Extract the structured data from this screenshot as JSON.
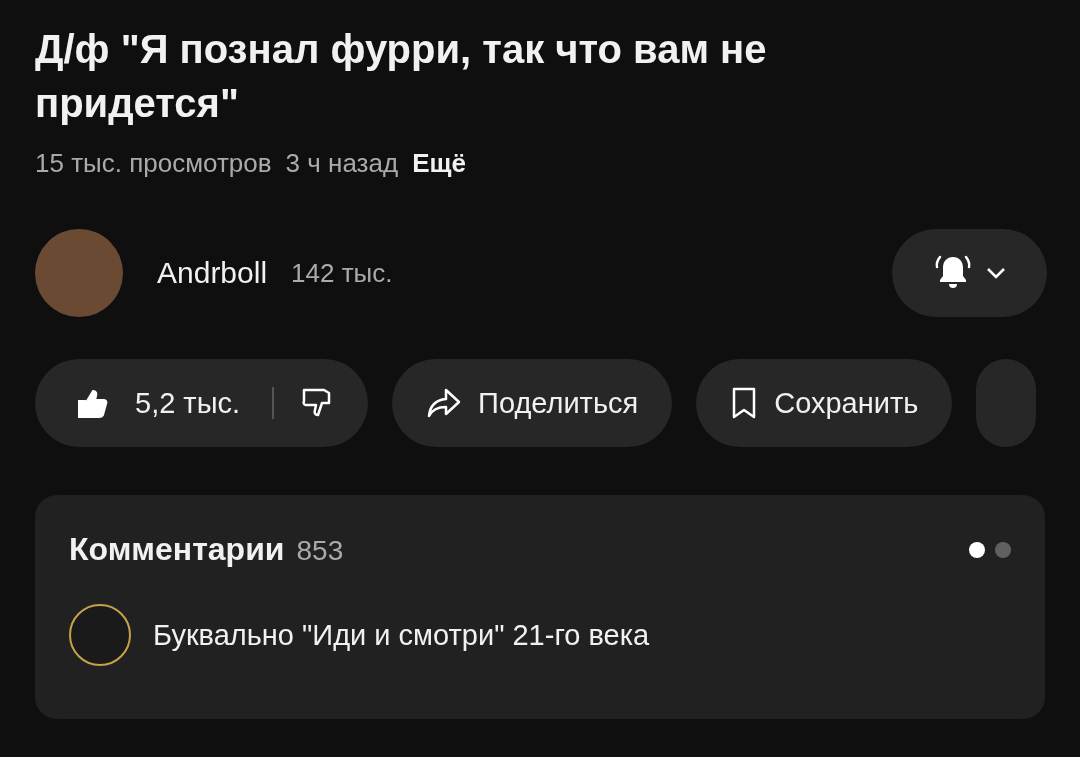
{
  "video": {
    "title": "Д/ф \"Я познал фурри, так что вам не придется\"",
    "views": "15 тыс. просмотров",
    "age": "3 ч назад",
    "more": "Ещё"
  },
  "channel": {
    "name": "Andrboll",
    "subscribers": "142 тыс.",
    "notifications_on": true
  },
  "actions": {
    "likes": "5,2 тыс.",
    "liked": true,
    "disliked": false,
    "share": "Поделиться",
    "save": "Сохранить"
  },
  "comments": {
    "title": "Комментарии",
    "count": "853",
    "pages": [
      {
        "selected": true
      },
      {
        "selected": false
      }
    ],
    "top_comment": "Буквально \"Иди и смотри\" 21-го века"
  }
}
